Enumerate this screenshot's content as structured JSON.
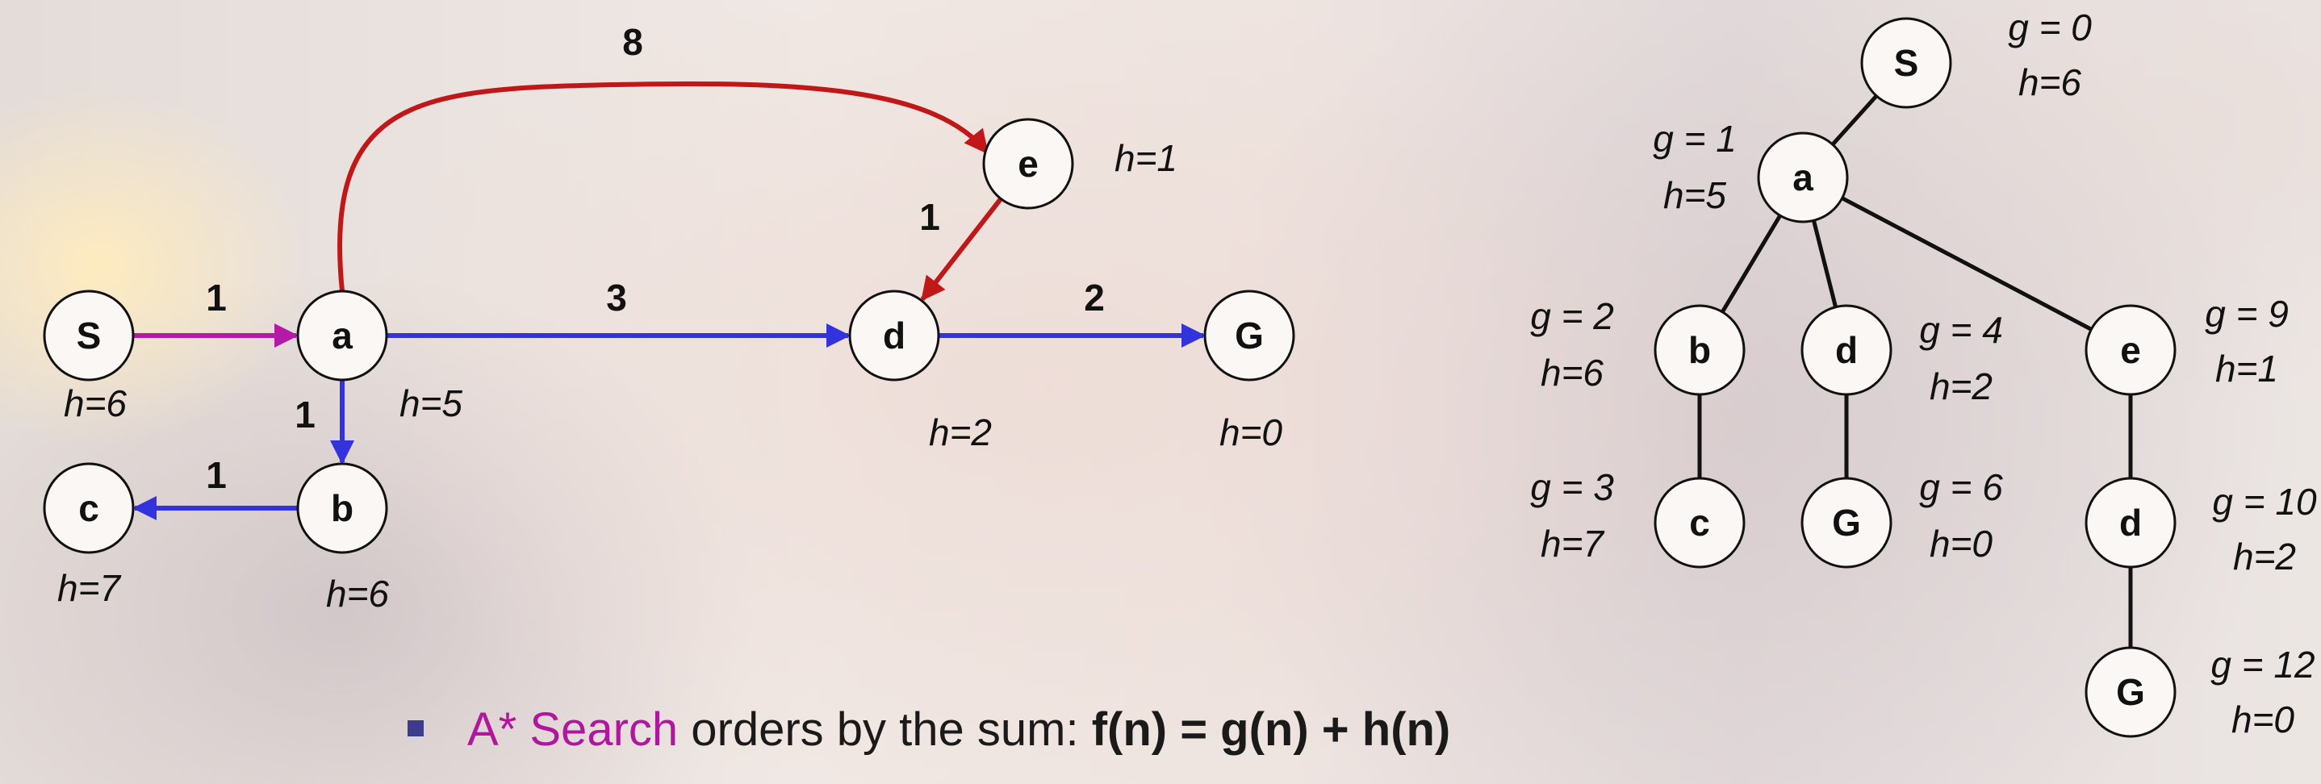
{
  "graph": {
    "nodes": [
      {
        "id": "S",
        "label": "S",
        "h": "h=6"
      },
      {
        "id": "a",
        "label": "a",
        "h": "h=5"
      },
      {
        "id": "b",
        "label": "b",
        "h": "h=6"
      },
      {
        "id": "c",
        "label": "c",
        "h": "h=7"
      },
      {
        "id": "d",
        "label": "d",
        "h": "h=2"
      },
      {
        "id": "e",
        "label": "e",
        "h": "h=1"
      },
      {
        "id": "G",
        "label": "G",
        "h": "h=0"
      }
    ],
    "edges": [
      {
        "from": "S",
        "to": "a",
        "weight": "1",
        "color": "#b51aa6"
      },
      {
        "from": "a",
        "to": "b",
        "weight": "1",
        "color": "#3333dd"
      },
      {
        "from": "b",
        "to": "c",
        "weight": "1",
        "color": "#3333dd"
      },
      {
        "from": "a",
        "to": "d",
        "weight": "3",
        "color": "#3333dd"
      },
      {
        "from": "d",
        "to": "G",
        "weight": "2",
        "color": "#3333dd"
      },
      {
        "from": "a",
        "to": "e",
        "weight": "8",
        "color": "#c01818"
      },
      {
        "from": "e",
        "to": "d",
        "weight": "1",
        "color": "#c01818"
      }
    ]
  },
  "tree": {
    "nodes": [
      {
        "id": "t_S",
        "label": "S",
        "g": "g = 0",
        "h": "h=6"
      },
      {
        "id": "t_a",
        "label": "a",
        "g": "g = 1",
        "h": "h=5"
      },
      {
        "id": "t_b",
        "label": "b",
        "g": "g = 2",
        "h": "h=6"
      },
      {
        "id": "t_d1",
        "label": "d",
        "g": "g = 4",
        "h": "h=2"
      },
      {
        "id": "t_e",
        "label": "e",
        "g": "g = 9",
        "h": "h=1"
      },
      {
        "id": "t_c",
        "label": "c",
        "g": "g = 3",
        "h": "h=7"
      },
      {
        "id": "t_G1",
        "label": "G",
        "g": "g = 6",
        "h": "h=0"
      },
      {
        "id": "t_d2",
        "label": "d",
        "g": "g = 10",
        "h": "h=2"
      },
      {
        "id": "t_G2",
        "label": "G",
        "g": "g = 12",
        "h": "h=0"
      }
    ],
    "edges": [
      {
        "from": "t_S",
        "to": "t_a"
      },
      {
        "from": "t_a",
        "to": "t_b"
      },
      {
        "from": "t_a",
        "to": "t_d1"
      },
      {
        "from": "t_a",
        "to": "t_e"
      },
      {
        "from": "t_b",
        "to": "t_c"
      },
      {
        "from": "t_d1",
        "to": "t_G1"
      },
      {
        "from": "t_e",
        "to": "t_d2"
      },
      {
        "from": "t_d2",
        "to": "t_G2"
      }
    ]
  },
  "caption": {
    "highlight": "A* Search",
    "text": " orders by the sum: ",
    "formula": "f(n) = g(n) + h(n)"
  },
  "colors": {
    "highlight": "#b0179e",
    "bullet": "#3b3b8f"
  }
}
